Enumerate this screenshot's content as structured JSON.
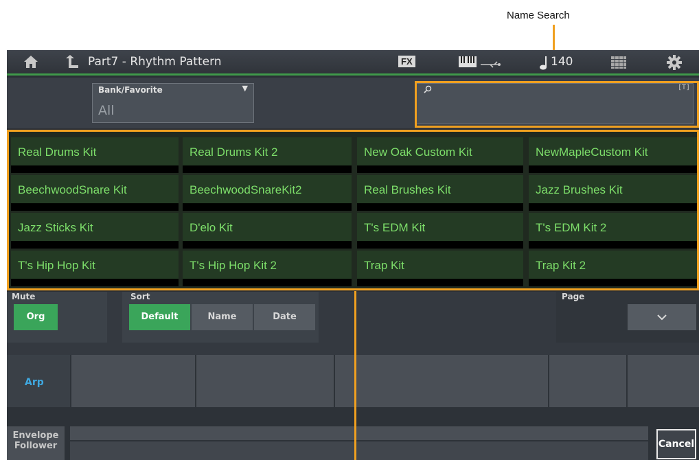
{
  "callout": {
    "name_search_label": "Name Search"
  },
  "titlebar": {
    "title": "Part7 - Rhythm Pattern",
    "fx_label": "FX",
    "tempo": "140",
    "icons": [
      "home-icon",
      "back-arrow-icon",
      "fx-icon",
      "keyboard-icon",
      "usb-icon",
      "note-icon",
      "grid-icon",
      "gear-icon"
    ]
  },
  "bank": {
    "label": "Bank/Favorite",
    "value": "All"
  },
  "search": {
    "placeholder": "",
    "keyboard_hint": "[T]"
  },
  "grid": [
    [
      "Real Drums Kit",
      "Real Drums Kit 2",
      "New Oak Custom Kit",
      "NewMapleCustom Kit"
    ],
    [
      "BeechwoodSnare Kit",
      "BeechwoodSnareKit2",
      "Real Brushes Kit",
      "Jazz Brushes Kit"
    ],
    [
      "Jazz Sticks Kit",
      "D'elo Kit",
      "T's EDM Kit",
      "T's EDM Kit 2"
    ],
    [
      "T's Hip Hop Kit",
      "T's Hip Hop Kit 2",
      "Trap Kit",
      "Trap Kit 2"
    ]
  ],
  "mute": {
    "label": "Mute",
    "button": "Org"
  },
  "sort": {
    "label": "Sort",
    "options": [
      "Default",
      "Name",
      "Date"
    ],
    "selected": "Default"
  },
  "page": {
    "label": "Page"
  },
  "lower": {
    "arp_label": "Arp",
    "envelope_follower": [
      "Envelope",
      "Follower"
    ],
    "cancel_label": "Cancel"
  },
  "colors": {
    "accent_green": "#3aa55a",
    "item_text": "#7dde6a",
    "highlight": "#f0a020",
    "arp_blue": "#3fa8e0"
  }
}
